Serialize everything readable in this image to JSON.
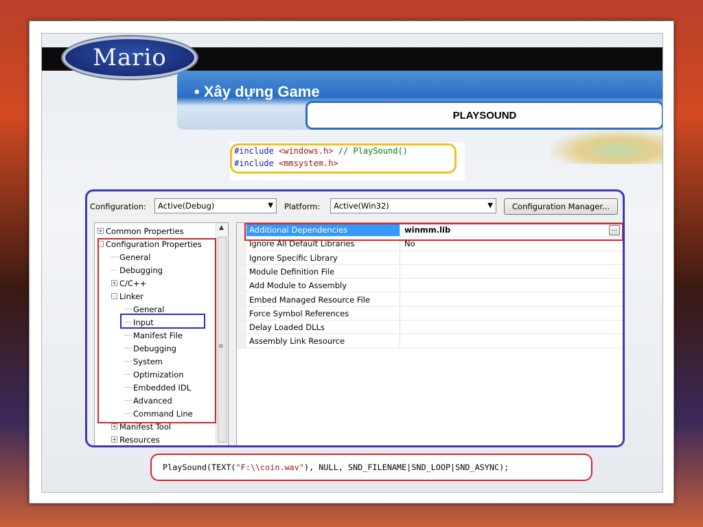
{
  "slide": {
    "logo_text": "Mario",
    "title": "• Xây dựng Game",
    "subtitle": "PLAYSOUND"
  },
  "include_code": {
    "line1": {
      "kw": "#include",
      "header": "<windows.h>",
      "comment": "// PlaySound()"
    },
    "line2": {
      "kw": "#include",
      "header": "<mmsystem.h>"
    }
  },
  "dialog": {
    "configuration_label": "Configuration:",
    "configuration_value": "Active(Debug)",
    "platform_label": "Platform:",
    "platform_value": "Active(Win32)",
    "config_manager_button": "Configuration Manager...",
    "tree": [
      {
        "label": "Common Properties",
        "expander": "+"
      },
      {
        "label": "Configuration Properties",
        "expander": "-"
      },
      {
        "label": "General"
      },
      {
        "label": "Debugging"
      },
      {
        "label": "C/C++",
        "expander": "+"
      },
      {
        "label": "Linker",
        "expander": "-"
      },
      {
        "label": "General"
      },
      {
        "label": "Input"
      },
      {
        "label": "Manifest File"
      },
      {
        "label": "Debugging"
      },
      {
        "label": "System"
      },
      {
        "label": "Optimization"
      },
      {
        "label": "Embedded IDL"
      },
      {
        "label": "Advanced"
      },
      {
        "label": "Command Line"
      },
      {
        "label": "Manifest Tool",
        "expander": "+"
      },
      {
        "label": "Resources",
        "expander": "+"
      }
    ],
    "properties": [
      {
        "name": "Additional Dependencies",
        "value": "winmm.lib",
        "ellipsis": "..."
      },
      {
        "name": "Ignore All Default Libraries",
        "value": "No"
      },
      {
        "name": "Ignore Specific Library",
        "value": ""
      },
      {
        "name": "Module Definition File",
        "value": ""
      },
      {
        "name": "Add Module to Assembly",
        "value": ""
      },
      {
        "name": "Embed Managed Resource File",
        "value": ""
      },
      {
        "name": "Force Symbol References",
        "value": ""
      },
      {
        "name": "Delay Loaded DLLs",
        "value": ""
      },
      {
        "name": "Assembly Link Resource",
        "value": ""
      }
    ]
  },
  "playsound_code": {
    "prefix": "PlaySound(TEXT(",
    "string": "\"F:\\\\coin.wav\"",
    "suffix": "), NULL, SND_FILENAME|SND_LOOP|SND_ASYNC);"
  }
}
